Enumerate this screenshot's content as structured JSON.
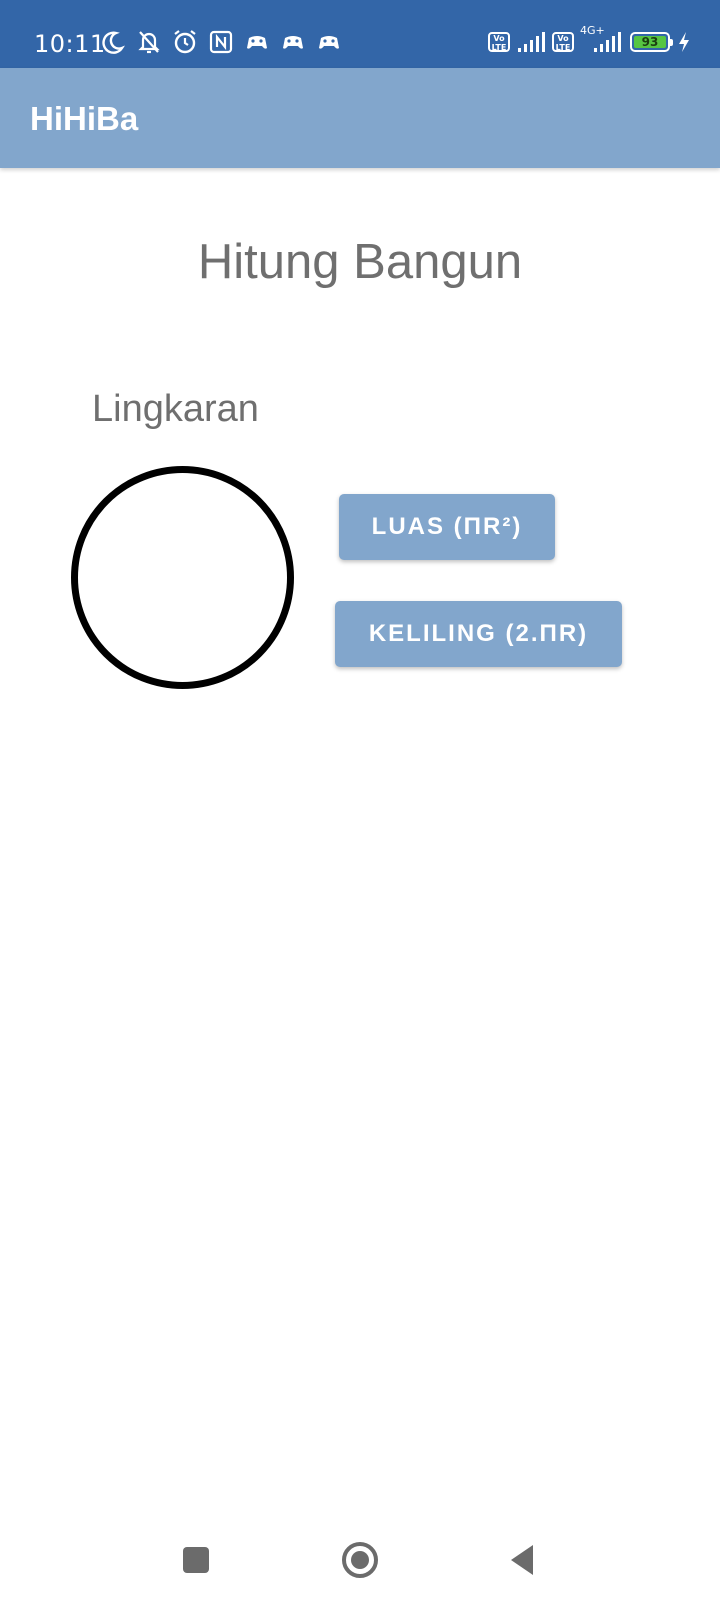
{
  "status_bar": {
    "time": "10:11",
    "battery_level": "93",
    "network_type": "4G+",
    "lte_badge": "Vo LTE",
    "icons_left": [
      "moon-icon",
      "bell-off-icon",
      "alarm-icon",
      "nfc-icon",
      "game-controller-icon",
      "game-controller-icon",
      "game-controller-icon"
    ],
    "icons_right": [
      "volte-icon",
      "signal-icon",
      "volte-icon",
      "signal-4g-icon",
      "battery-icon",
      "charging-icon"
    ]
  },
  "app_bar": {
    "title": "HiHiBa"
  },
  "main": {
    "heading": "Hitung Bangun",
    "shape_label": "Lingkaran",
    "buttons": {
      "luas_label": "LUAS (ΠR²)",
      "keliling_label": "KELILING (2.ΠR)"
    }
  },
  "nav_bar": {
    "buttons": [
      "recents-button",
      "home-button",
      "back-button"
    ]
  },
  "colors": {
    "status_bar": "#3366a8",
    "app_bar": "#82a6cc",
    "button": "#82a6cc",
    "text_gray": "#6f6f6f"
  }
}
